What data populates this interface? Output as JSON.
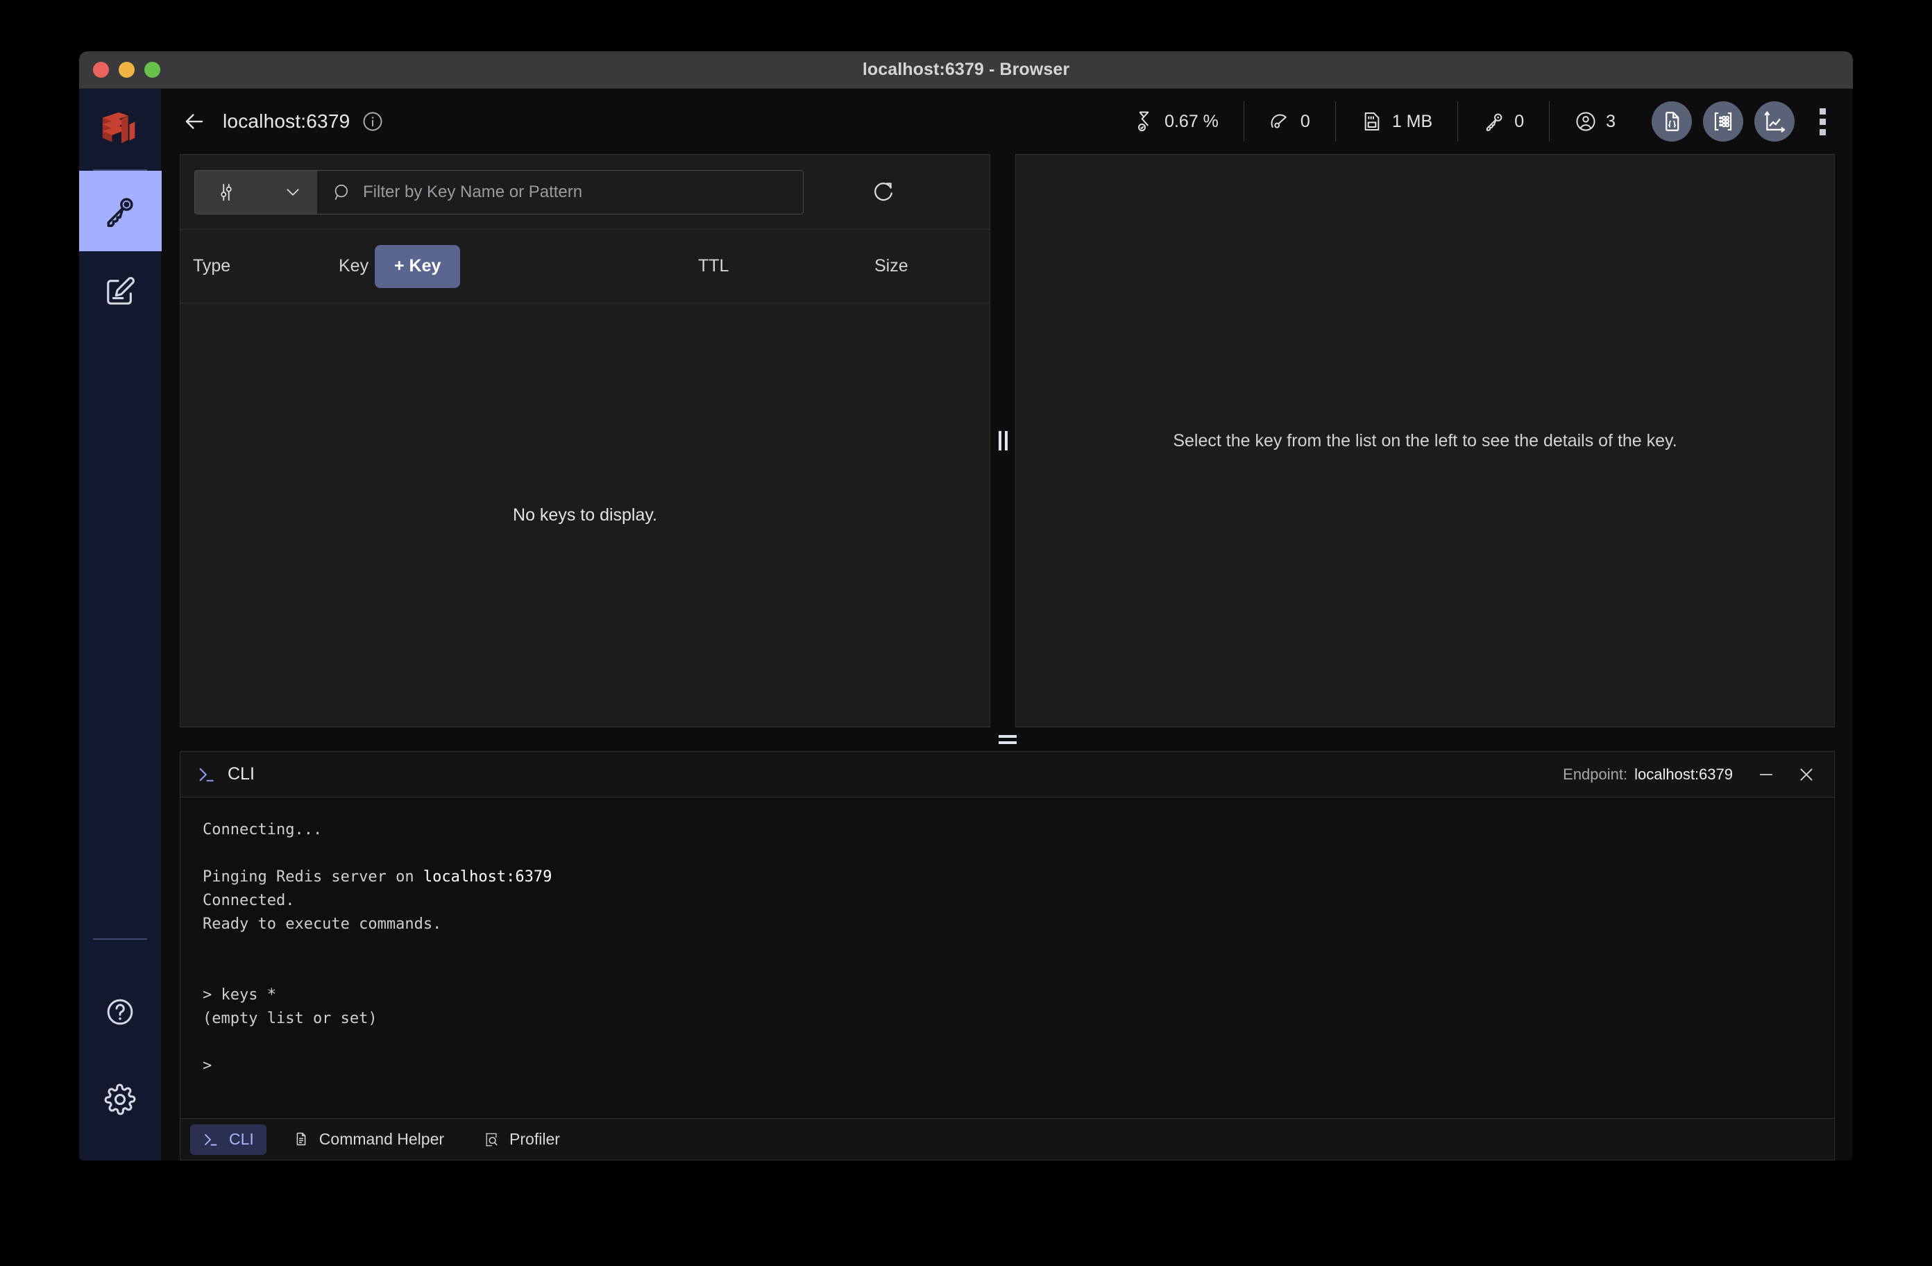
{
  "window": {
    "title": "localhost:6379 - Browser",
    "traffic_lights": [
      "close",
      "minimize",
      "maximize"
    ]
  },
  "rail": {
    "logo": "redis-logo",
    "items": [
      {
        "name": "browser",
        "icon": "key-icon",
        "active": true
      },
      {
        "name": "workbench",
        "icon": "edit-document-icon",
        "active": false
      }
    ],
    "bottom_items": [
      {
        "name": "help",
        "icon": "help-circle-icon"
      },
      {
        "name": "settings",
        "icon": "gear-icon"
      }
    ]
  },
  "toolbar": {
    "back_icon": "arrow-left-icon",
    "database_name": "localhost:6379",
    "info_icon": "info-circle-icon",
    "metrics": [
      {
        "icon": "hourglass-icon",
        "value": "0.67 %",
        "name": "cpu"
      },
      {
        "icon": "gauge-icon",
        "value": "0",
        "name": "commands-per-second"
      },
      {
        "icon": "memory-card-icon",
        "value": "1 MB",
        "name": "memory"
      },
      {
        "icon": "key-icon",
        "value": "0",
        "name": "keys-count"
      },
      {
        "icon": "user-circle-icon",
        "value": "3",
        "name": "connected-clients"
      }
    ],
    "round_buttons": [
      {
        "name": "json-document",
        "icon": "json-file-icon"
      },
      {
        "name": "matrix",
        "icon": "matrix-grid-icon"
      },
      {
        "name": "analysis",
        "icon": "line-chart-icon"
      }
    ],
    "overflow_icon": "vertical-dots-icon"
  },
  "filter": {
    "type_icon": "sliders-icon",
    "chevron_icon": "chevron-down-icon",
    "search_icon": "search-icon",
    "placeholder": "Filter by Key Name or Pattern",
    "value": "",
    "refresh_icon": "refresh-icon"
  },
  "keys_table": {
    "columns": [
      "Type",
      "Key",
      "TTL",
      "Size"
    ],
    "add_key_label": "+ Key",
    "rows": [],
    "empty_message": "No keys to display."
  },
  "details": {
    "empty_message": "Select the key from the list on the left to see the details of the key."
  },
  "cli": {
    "prompt_icon": "terminal-icon",
    "title": "CLI",
    "endpoint_label": "Endpoint:",
    "endpoint_value": "localhost:6379",
    "minimize_icon": "minimize-icon",
    "close_icon": "close-icon",
    "output_lines": [
      {
        "text": "Connecting...",
        "highlight": false
      },
      {
        "text": "",
        "highlight": false
      },
      {
        "text": "Pinging Redis server on ",
        "suffix": "localhost:6379",
        "highlight": true
      },
      {
        "text": "Connected.",
        "highlight": false
      },
      {
        "text": "Ready to execute commands.",
        "highlight": false
      },
      {
        "text": "",
        "highlight": false
      },
      {
        "text": "",
        "highlight": false
      },
      {
        "text": "> keys *",
        "highlight": false
      },
      {
        "text": "(empty list or set)",
        "highlight": false
      },
      {
        "text": "",
        "highlight": false
      },
      {
        "text": ">",
        "highlight": false
      }
    ],
    "tabs": [
      {
        "label": "CLI",
        "icon": "terminal-icon",
        "active": true
      },
      {
        "label": "Command Helper",
        "icon": "document-icon",
        "active": false
      },
      {
        "label": "Profiler",
        "icon": "profiler-icon",
        "active": false
      }
    ]
  },
  "colors": {
    "accent": "#a3b0ff",
    "brand_red": "#c6412f",
    "rail_bg": "#12182d",
    "panel_bg": "#1c1c1c",
    "app_bg": "#0d0d0d",
    "button_blue": "#5a6590"
  }
}
